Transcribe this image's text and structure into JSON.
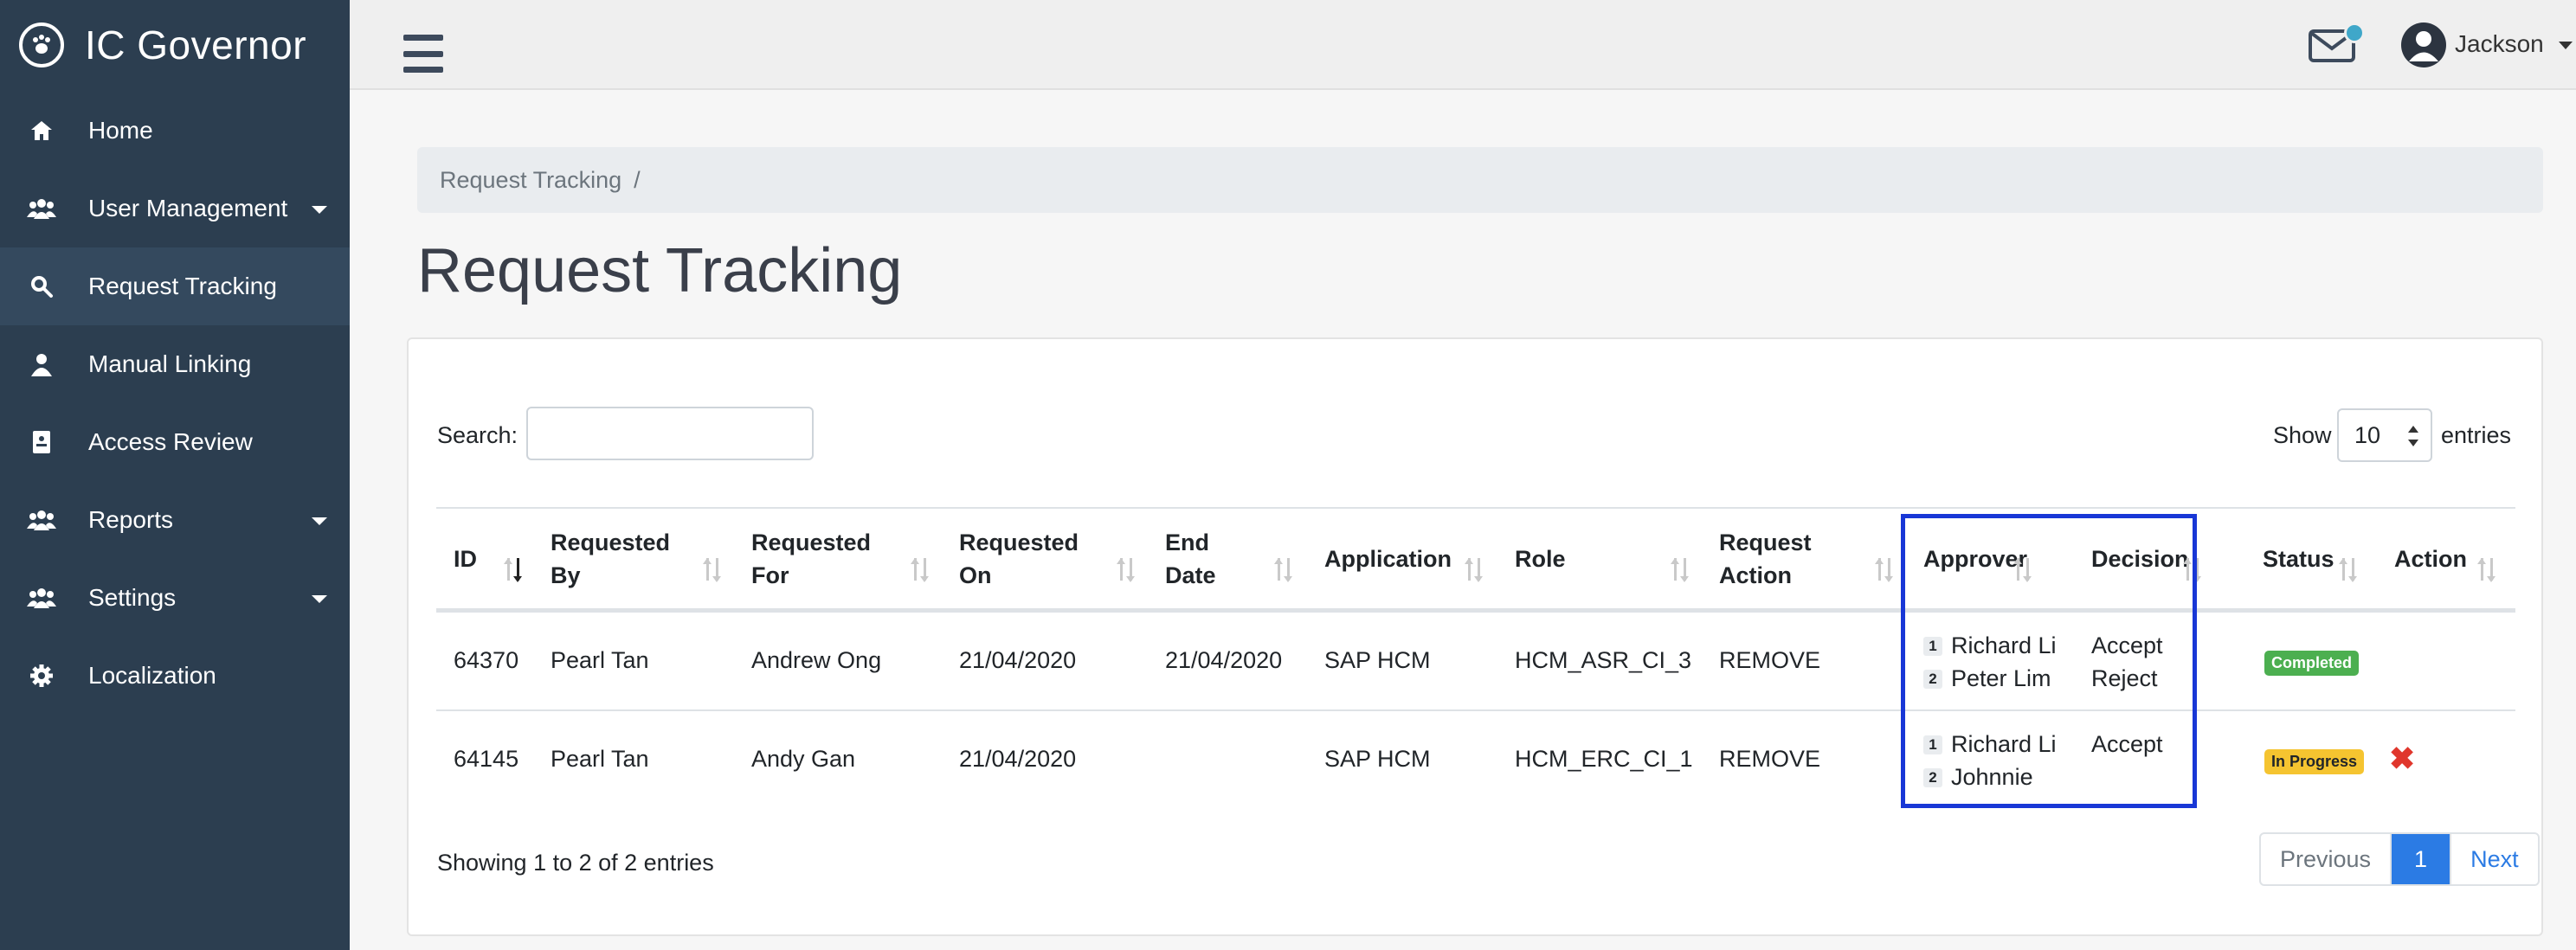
{
  "app": {
    "name": "IC Governor"
  },
  "sidebar": {
    "items": [
      {
        "label": "Home",
        "icon": "home-icon",
        "caret": false
      },
      {
        "label": "User Management",
        "icon": "users-icon",
        "caret": true
      },
      {
        "label": "Request Tracking",
        "icon": "search-icon",
        "caret": false,
        "active": true
      },
      {
        "label": "Manual Linking",
        "icon": "user-icon",
        "caret": false
      },
      {
        "label": "Access Review",
        "icon": "clipboard-icon",
        "caret": false
      },
      {
        "label": "Reports",
        "icon": "users-icon",
        "caret": true
      },
      {
        "label": "Settings",
        "icon": "users-icon",
        "caret": true
      },
      {
        "label": "Localization",
        "icon": "gear-icon",
        "caret": false
      }
    ]
  },
  "topbar": {
    "user_name": "Jackson"
  },
  "breadcrumb": {
    "current": "Request Tracking",
    "separator": "/"
  },
  "page": {
    "title": "Request Tracking"
  },
  "controls": {
    "search_label": "Search:",
    "search_value": "",
    "show_label": "Show",
    "entries_value": "10",
    "entries_label": "entries"
  },
  "table": {
    "headers": [
      {
        "line1": "ID",
        "line2": ""
      },
      {
        "line1": "Requested",
        "line2": "By"
      },
      {
        "line1": "Requested",
        "line2": "For"
      },
      {
        "line1": "Requested",
        "line2": "On"
      },
      {
        "line1": "End",
        "line2": "Date"
      },
      {
        "line1": "Application",
        "line2": ""
      },
      {
        "line1": "Role",
        "line2": ""
      },
      {
        "line1": "Request",
        "line2": "Action"
      },
      {
        "line1": "Approver",
        "line2": ""
      },
      {
        "line1": "Decision",
        "line2": ""
      },
      {
        "line1": "Status",
        "line2": ""
      },
      {
        "line1": "Action",
        "line2": ""
      }
    ],
    "rows": [
      {
        "id": "64370",
        "requested_by": "Pearl Tan",
        "requested_for": "Andrew Ong",
        "requested_on": "21/04/2020",
        "end_date": "21/04/2020",
        "application": "SAP HCM",
        "role": "HCM_ASR_CI_3",
        "request_action": "REMOVE",
        "approvers": [
          {
            "n": "1",
            "name": "Richard Li"
          },
          {
            "n": "2",
            "name": "Peter Lim"
          }
        ],
        "decisions": [
          "Accept",
          "Reject"
        ],
        "status": "Completed",
        "status_color": "#4caf50",
        "action": ""
      },
      {
        "id": "64145",
        "requested_by": "Pearl Tan",
        "requested_for": "Andy Gan",
        "requested_on": "21/04/2020",
        "end_date": "",
        "application": "SAP HCM",
        "role": "HCM_ERC_CI_1",
        "request_action": "REMOVE",
        "approvers": [
          {
            "n": "1",
            "name": "Richard Li"
          },
          {
            "n": "2",
            "name": "Johnnie"
          }
        ],
        "decisions": [
          "Accept"
        ],
        "status": "In Progress",
        "status_color": "#f5c430",
        "action": "✖"
      }
    ]
  },
  "footer": {
    "info": "Showing 1 to 2 of 2 entries"
  },
  "pagination": {
    "previous": "Previous",
    "current": "1",
    "next": "Next"
  },
  "colors": {
    "sidebar": "#2c3e50",
    "accent": "#2b7be4",
    "highlight_box": "#1837d6"
  }
}
